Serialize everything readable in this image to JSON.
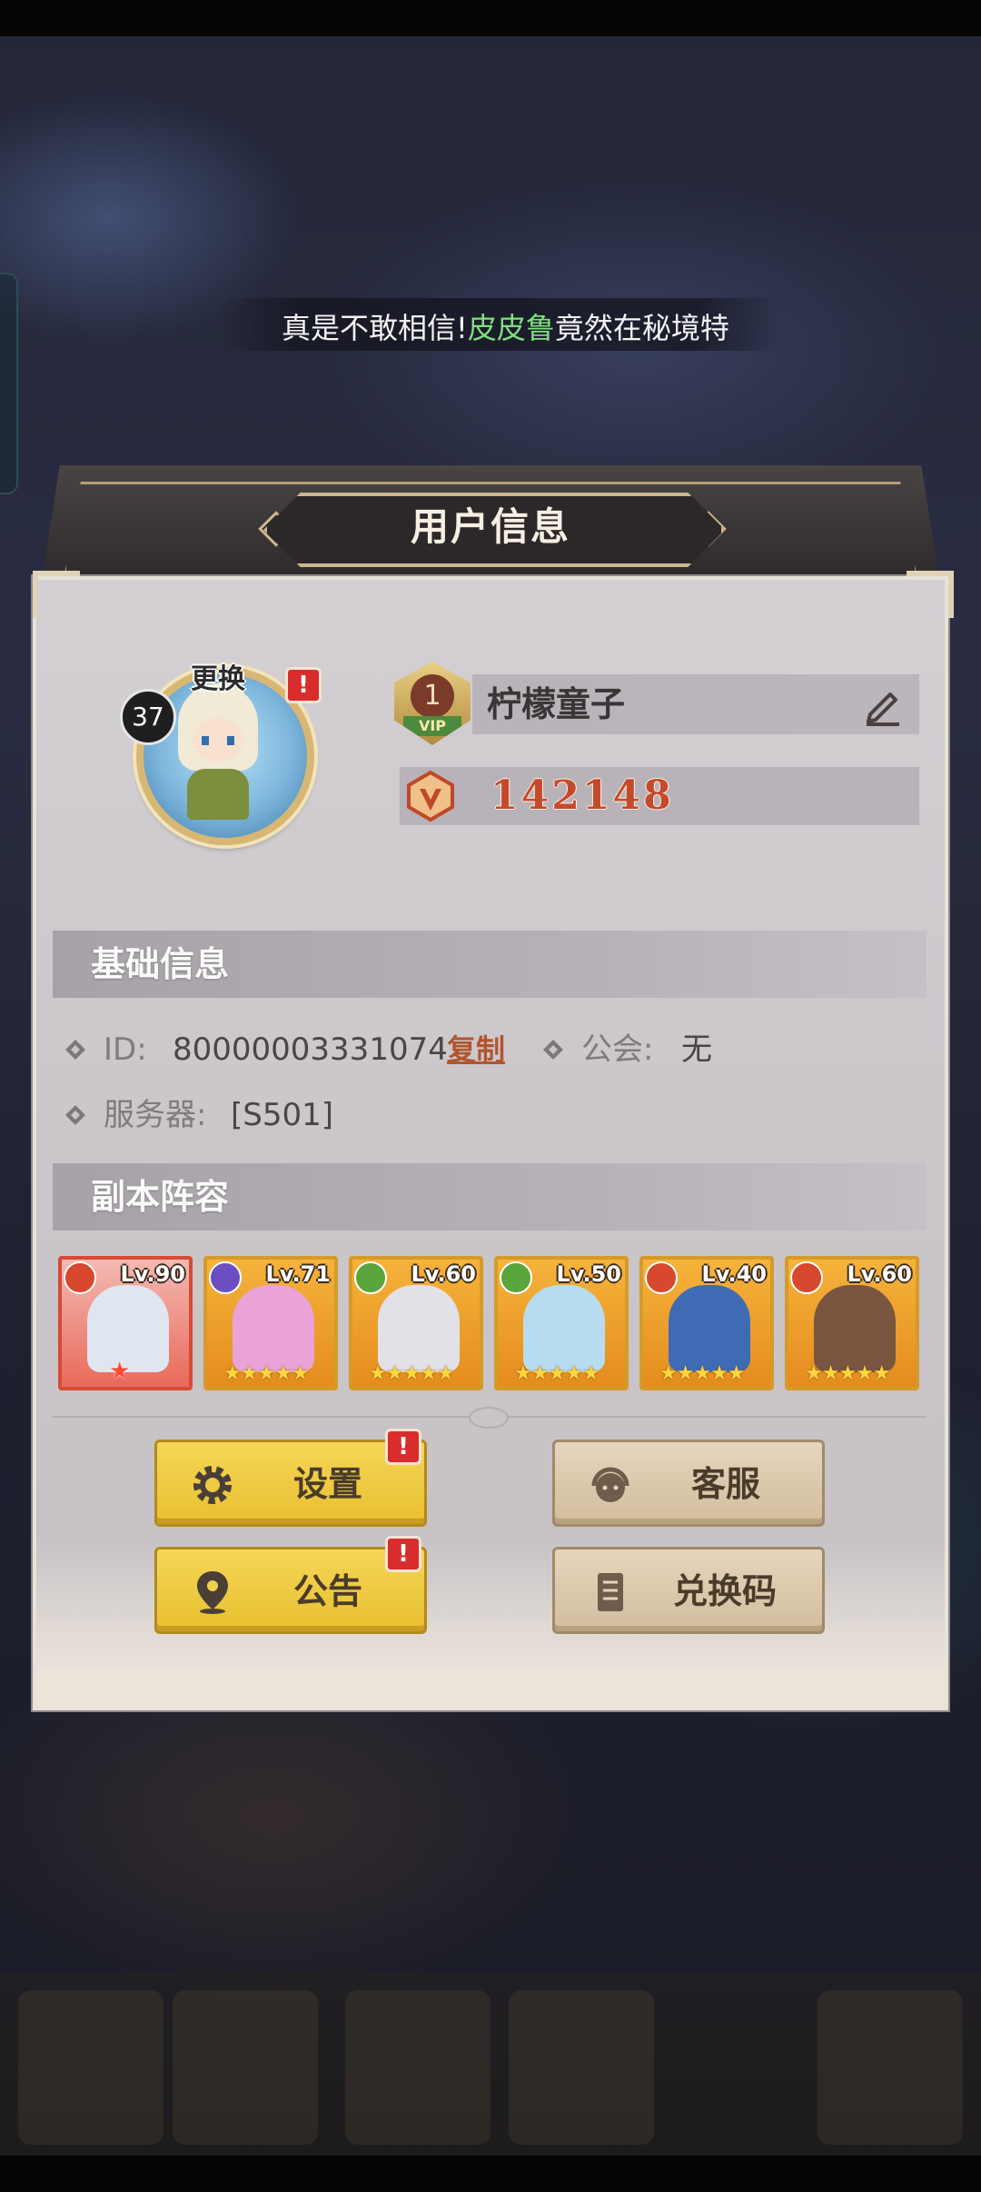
{
  "marquee": {
    "prefix": "真是不敢相信!",
    "highlight": "皮皮鲁",
    "suffix": "竟然在秘境特"
  },
  "dialog": {
    "title": "用户信息"
  },
  "profile": {
    "change_label": "更换",
    "level": "37",
    "alert_mark": "!",
    "vip_level": "1",
    "vip_tag": "VIP",
    "name": "柠檬童子",
    "power": "142148"
  },
  "basic_info": {
    "title": "基础信息",
    "id_label": "ID:",
    "id_value": "80000003331074",
    "copy_label": "复制",
    "guild_label": "公会:",
    "guild_value": "无",
    "server_label": "服务器:",
    "server_value": "[S501]"
  },
  "lineup": {
    "title": "副本阵容",
    "heroes": [
      {
        "level": "Lv.90",
        "stars": "★",
        "element": "fire",
        "frame": "red"
      },
      {
        "level": "Lv.71",
        "stars": "★★★★★",
        "element": "light",
        "frame": "orange"
      },
      {
        "level": "Lv.60",
        "stars": "★★★★★",
        "element": "nature",
        "frame": "orange"
      },
      {
        "level": "Lv.50",
        "stars": "★★★★★",
        "element": "nature",
        "frame": "orange"
      },
      {
        "level": "Lv.40",
        "stars": "★★★★★",
        "element": "fire",
        "frame": "orange"
      },
      {
        "level": "Lv.60",
        "stars": "★★★★★",
        "element": "fire",
        "frame": "orange"
      }
    ]
  },
  "buttons": {
    "settings": "设置",
    "customer_service": "客服",
    "announcement": "公告",
    "redeem_code": "兑换码"
  },
  "colors": {
    "highlight_green": "#7ee07e",
    "power_red": "#c44a2d",
    "alert_red": "#d92d2d",
    "button_yellow": "#f5d657",
    "button_beige": "#e6d5bd"
  }
}
